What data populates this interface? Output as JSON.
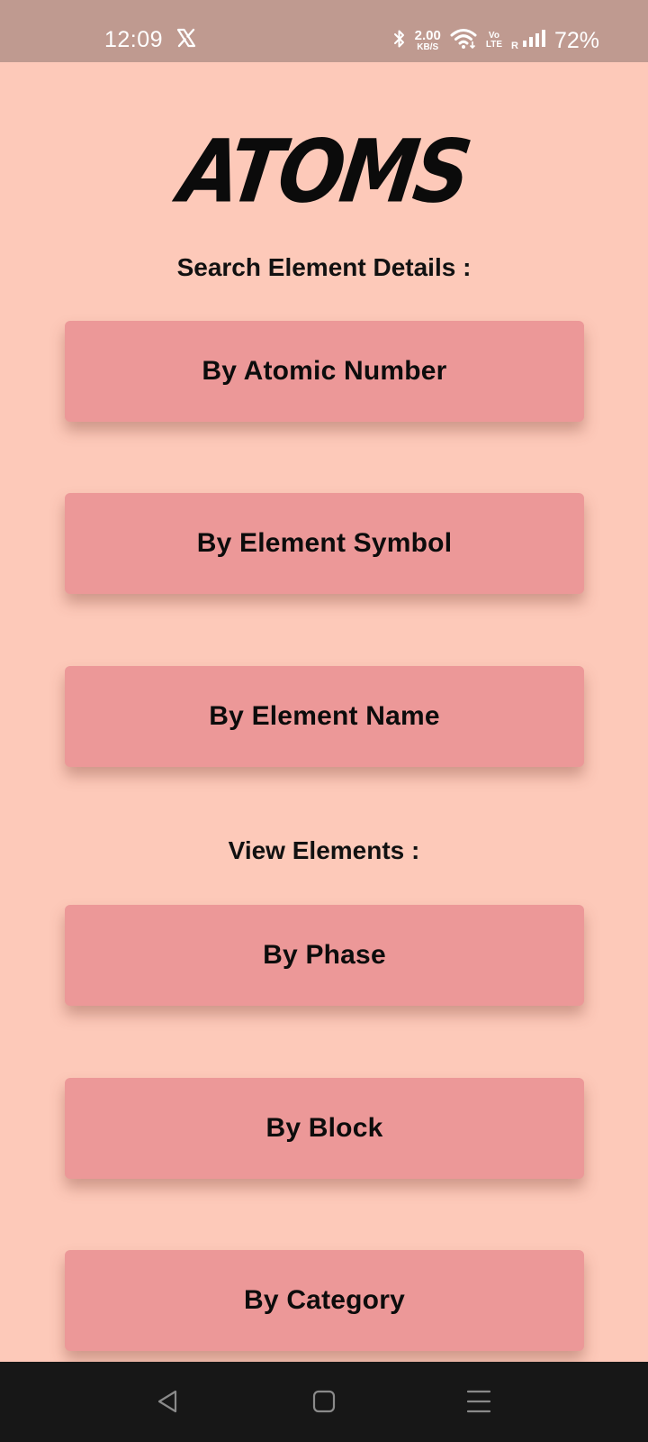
{
  "status_bar": {
    "time": "12:09",
    "x_icon": "x-logo-icon",
    "bluetooth_icon": "bluetooth-icon",
    "net_speed_value": "2.00",
    "net_speed_unit": "KB/S",
    "wifi_icon": "wifi-icon",
    "volte_top": "Vo",
    "volte_bottom": "LTE",
    "roaming": "R",
    "signal_icon": "signal-icon",
    "battery": "72%"
  },
  "app": {
    "logo": "ATOMS",
    "search_label": "Search Element Details :",
    "search_buttons": [
      {
        "label": "By Atomic Number"
      },
      {
        "label": "By Element Symbol"
      },
      {
        "label": "By Element Name"
      }
    ],
    "view_label": "View Elements :",
    "view_buttons": [
      {
        "label": "By Phase"
      },
      {
        "label": "By Block"
      },
      {
        "label": "By Category"
      }
    ]
  },
  "nav_bar": {
    "back_icon": "back-icon",
    "home_icon": "home-icon",
    "menu_icon": "recents-menu-icon"
  },
  "colors": {
    "background": "#fdc9b9",
    "status_bar": "#bf9a90",
    "button": "#ec9898",
    "nav_bar": "#171717"
  }
}
